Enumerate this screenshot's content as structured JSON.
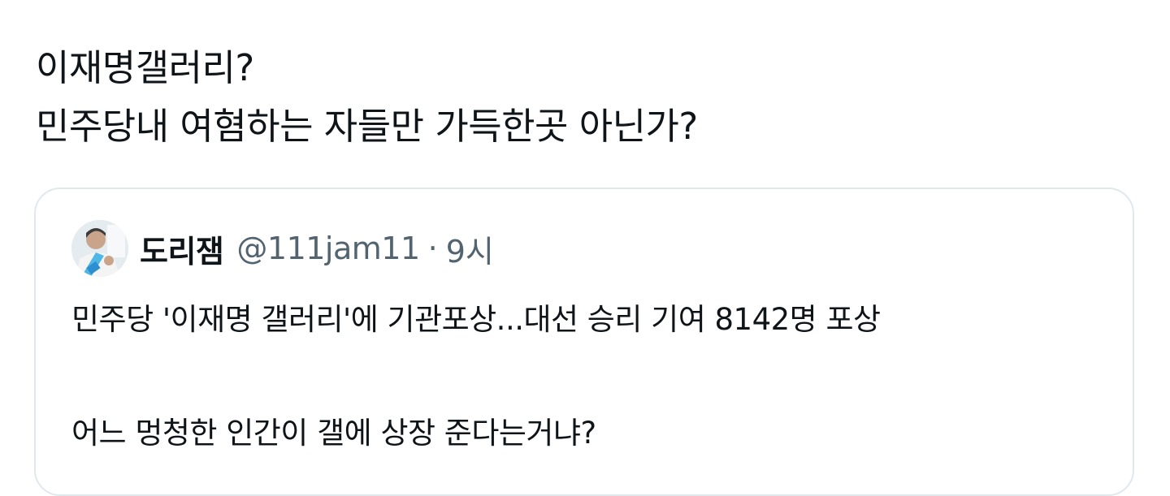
{
  "tweet": {
    "lines": [
      "이재명갤러리?",
      "민주당내 여혐하는 자들만 가득한곳 아닌가?"
    ]
  },
  "quoted_tweet": {
    "display_name": "도리잼",
    "handle": "@111jam11",
    "separator": "·",
    "time": "9시",
    "body": [
      "민주당 '이재명 갤러리'에 기관포상...대선 승리 기여 8142명 포상",
      "어느 멍청한 인간이 갤에 상장 준다는거냐?"
    ]
  },
  "colors": {
    "text": "#0f1419",
    "secondary": "#536471",
    "border": "#e1e8ed"
  },
  "icons": {
    "avatar": "profile-photo"
  }
}
